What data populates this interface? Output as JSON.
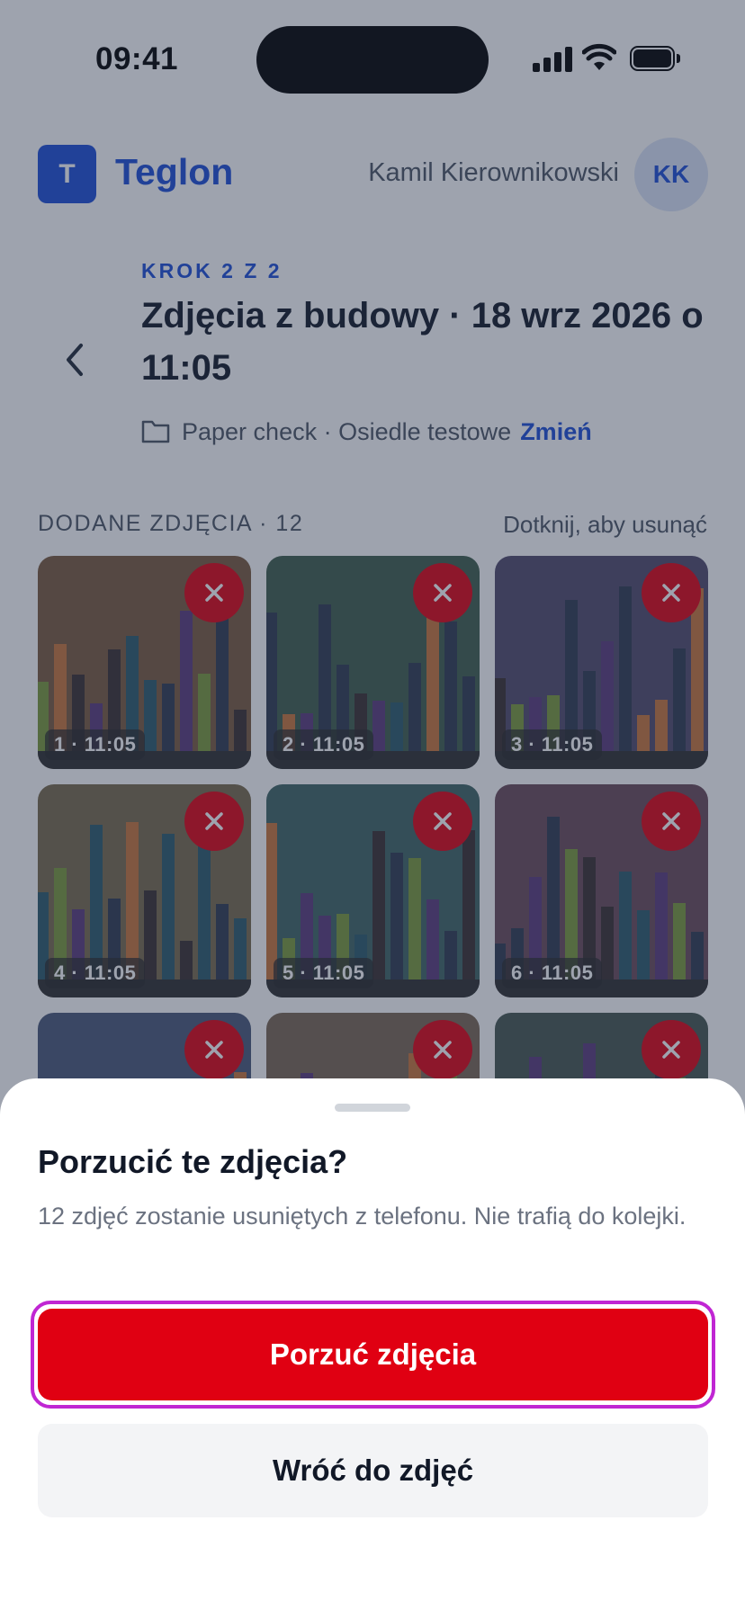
{
  "status_bar": {
    "time": "09:41"
  },
  "header": {
    "logo_letter": "T",
    "brand": "Teglon",
    "user_name": "Kamil Kierownikowski",
    "avatar_initials": "KK"
  },
  "step": {
    "label": "KROK 2 Z 2",
    "title": "Zdjęcia z budowy · 18 wrz 2026 o 11:05",
    "project": "Paper check · Osiedle testowe",
    "change_link": "Zmień"
  },
  "photos": {
    "label": "DODANE ZDJĘCIA · 12",
    "hint": "Dotknij, aby usunąć",
    "items": [
      {
        "caption": "1 · 11:05",
        "bg": "#7a5a3c"
      },
      {
        "caption": "2 · 11:05",
        "bg": "#3f5e4b"
      },
      {
        "caption": "3 · 11:05",
        "bg": "#514a6b"
      },
      {
        "caption": "4 · 11:05",
        "bg": "#786a4b"
      },
      {
        "caption": "5 · 11:05",
        "bg": "#3f6463"
      },
      {
        "caption": "6 · 11:05",
        "bg": "#6a4a58"
      },
      {
        "caption": "",
        "bg": "#4a5878"
      },
      {
        "caption": "",
        "bg": "#7a6652"
      },
      {
        "caption": "",
        "bg": "#45564f"
      }
    ]
  },
  "dialog": {
    "title": "Porzucić te zdjęcia?",
    "body": "12 zdjęć zostanie usuniętych z telefonu. Nie trafią do kolejki.",
    "confirm_label": "Porzuć zdjęcia",
    "cancel_label": "Wróć do zdjęć"
  },
  "colors": {
    "accent": "#1d4ed8",
    "danger": "#e00012",
    "focus_ring": "#c026d3"
  },
  "icons": {
    "back": "chevron-left-icon",
    "folder": "folder-icon",
    "delete": "close-icon"
  }
}
